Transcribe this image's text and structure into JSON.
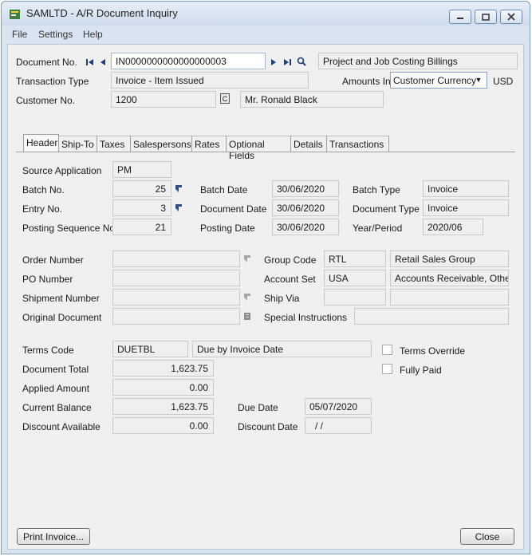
{
  "window": {
    "title": "SAMLTD - A/R Document Inquiry"
  },
  "menu": [
    "File",
    "Settings",
    "Help"
  ],
  "top": {
    "document_no_label": "Document No.",
    "document_no": "IN0000000000000000003",
    "document_description": "Project and Job Costing Billings",
    "transaction_type_label": "Transaction Type",
    "transaction_type": "Invoice - Item Issued",
    "amounts_in_label": "Amounts In",
    "amounts_in": "Customer Currency",
    "currency": "USD",
    "customer_no_label": "Customer No.",
    "customer_no": "1200",
    "customer_name": "Mr. Ronald Black"
  },
  "tabs": [
    {
      "label": "Header",
      "active": true
    },
    {
      "label": "Ship-To"
    },
    {
      "label": "Taxes"
    },
    {
      "label": "Salespersons"
    },
    {
      "label": "Rates"
    },
    {
      "label": "Optional Fields"
    },
    {
      "label": "Details"
    },
    {
      "label": "Transactions"
    }
  ],
  "header": {
    "source_application_label": "Source Application",
    "source_application": "PM",
    "batch_no_label": "Batch No.",
    "batch_no": "25",
    "entry_no_label": "Entry No.",
    "entry_no": "3",
    "posting_seq_label": "Posting Sequence No.",
    "posting_seq": "21",
    "batch_date_label": "Batch Date",
    "batch_date": "30/06/2020",
    "document_date_label": "Document Date",
    "document_date": "30/06/2020",
    "posting_date_label": "Posting Date",
    "posting_date": "30/06/2020",
    "batch_type_label": "Batch Type",
    "batch_type": "Invoice",
    "document_type_label": "Document Type",
    "document_type": "Invoice",
    "year_period_label": "Year/Period",
    "year_period": "2020/06",
    "order_number_label": "Order Number",
    "order_number": "",
    "po_number_label": "PO Number",
    "po_number": "",
    "shipment_number_label": "Shipment Number",
    "shipment_number": "",
    "original_document_label": "Original Document",
    "original_document": "",
    "group_code_label": "Group Code",
    "group_code": "RTL",
    "group_code_desc": "Retail Sales Group",
    "account_set_label": "Account Set",
    "account_set": "USA",
    "account_set_desc": "Accounts Receivable, Other",
    "ship_via_label": "Ship Via",
    "ship_via": "",
    "ship_via_desc": "",
    "special_instructions_label": "Special Instructions",
    "special_instructions": "",
    "terms_code_label": "Terms Code",
    "terms_code": "DUETBL",
    "terms_desc": "Due by Invoice Date",
    "terms_override_label": "Terms Override",
    "fully_paid_label": "Fully Paid",
    "document_total_label": "Document Total",
    "document_total": "1,623.75",
    "applied_amount_label": "Applied Amount",
    "applied_amount": "0.00",
    "current_balance_label": "Current Balance",
    "current_balance": "1,623.75",
    "discount_available_label": "Discount Available",
    "discount_available": "0.00",
    "due_date_label": "Due Date",
    "due_date": "05/07/2020",
    "discount_date_label": "Discount Date",
    "discount_date": "/  /"
  },
  "buttons": {
    "print_invoice": "Print Invoice...",
    "close": "Close"
  },
  "icons": {
    "app": "accpac-app-icon",
    "first": "first-record-icon",
    "previous": "previous-record-icon",
    "next": "next-record-icon",
    "last": "last-record-icon",
    "finder": "finder-magnifier-icon",
    "zoom": "zoom-drilldown-icon",
    "customer_info": "customer-info-icon"
  },
  "colors": {
    "window_frame": "#d9e4f1",
    "client_bg": "#f0f0f0",
    "nav_icon": "#1f3d7a"
  }
}
